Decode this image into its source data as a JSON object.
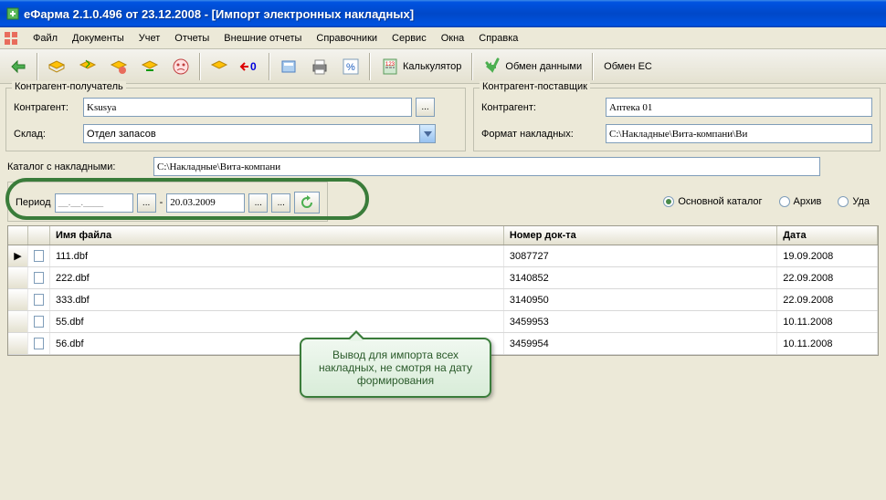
{
  "window": {
    "title": "еФарма 2.1.0.496 от 23.12.2008 - [Импорт электронных накладных]"
  },
  "menu": {
    "file": "Файл",
    "documents": "Документы",
    "accounting": "Учет",
    "reports": "Отчеты",
    "external_reports": "Внешние отчеты",
    "directories": "Справочники",
    "service": "Сервис",
    "windows": "Окна",
    "help": "Справка"
  },
  "toolbar": {
    "calculator": "Калькулятор",
    "exchange": "Обмен данными",
    "exchange_ec": "Обмен ЕС"
  },
  "recipient": {
    "legend": "Контрагент-получатель",
    "contractor_lbl": "Контрагент:",
    "contractor_val": "Ksusya",
    "warehouse_lbl": "Склад:",
    "warehouse_val": "Отдел запасов"
  },
  "supplier": {
    "legend": "Контрагент-поставщик",
    "contractor_lbl": "Контрагент:",
    "contractor_val": "Аптека 01",
    "format_lbl": "Формат накладных:",
    "format_val": "C:\\Накладные\\Вита-компани\\Ви"
  },
  "catalog": {
    "lbl": "Каталог с накладными:",
    "val": "C:\\Накладные\\Вита-компани"
  },
  "period": {
    "legend": "Период",
    "from": "__.__.____",
    "to": "20.03.2009"
  },
  "radios": {
    "main": "Основной каталог",
    "archive": "Архив",
    "delete": "Уда"
  },
  "grid": {
    "headers": {
      "file": "Имя файла",
      "doc": "Номер док-та",
      "date": "Дата"
    },
    "rows": [
      {
        "file": "111.dbf",
        "doc": "3087727",
        "date": "19.09.2008"
      },
      {
        "file": "222.dbf",
        "doc": "3140852",
        "date": "22.09.2008"
      },
      {
        "file": "333.dbf",
        "doc": "3140950",
        "date": "22.09.2008"
      },
      {
        "file": "55.dbf",
        "doc": "3459953",
        "date": "10.11.2008"
      },
      {
        "file": "56.dbf",
        "doc": "3459954",
        "date": "10.11.2008"
      }
    ]
  },
  "callout": {
    "text": "Вывод для импорта всех накладных, не смотря на дату формирования"
  }
}
